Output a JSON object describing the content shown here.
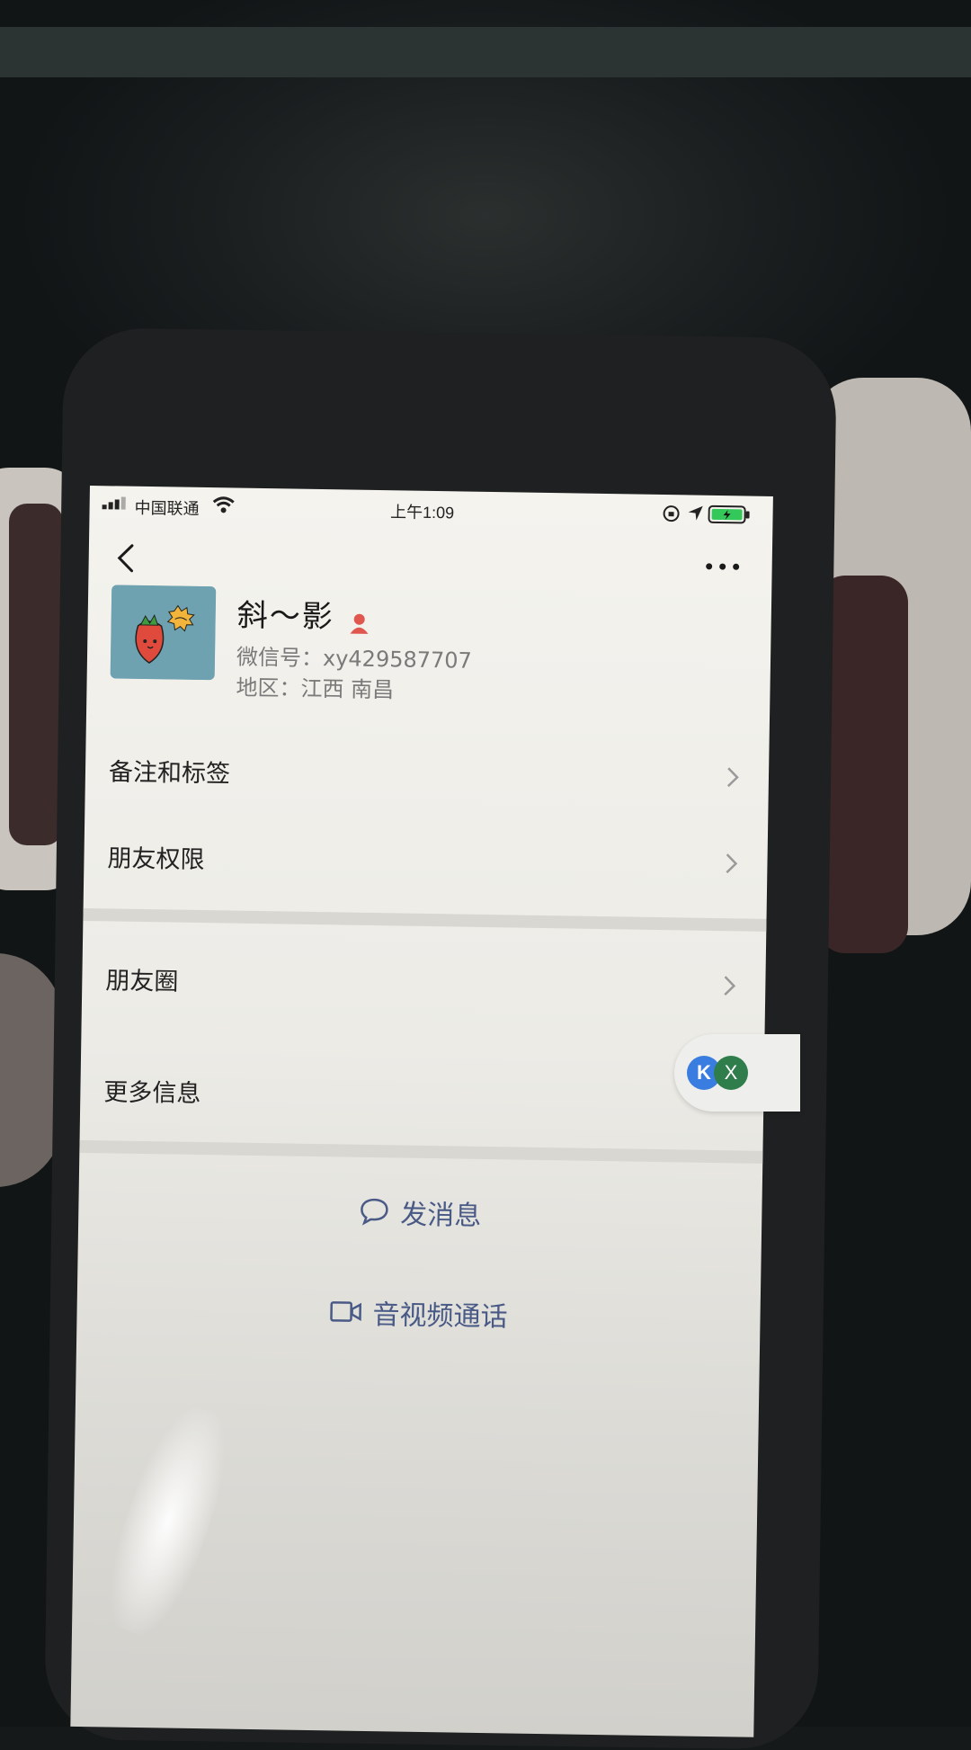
{
  "status_bar": {
    "carrier": "中国联通",
    "time": "上午1:09"
  },
  "profile": {
    "nickname": "斜～影",
    "wechat_id": "微信号：xy429587707",
    "region": "地区：江西 南昌"
  },
  "menu": {
    "remarks_tags": "备注和标签",
    "friend_permissions": "朋友权限",
    "moments": "朋友圈",
    "more_info": "更多信息"
  },
  "actions": {
    "send_message": "发消息",
    "video_call": "音视频通话"
  },
  "float_bubble": {
    "close_label": "X"
  },
  "colors": {
    "action_text": "#4a5a86",
    "gender_icon": "#e0574f",
    "battery_fill": "#34c759",
    "avatar_bg": "#6fa2b0"
  }
}
